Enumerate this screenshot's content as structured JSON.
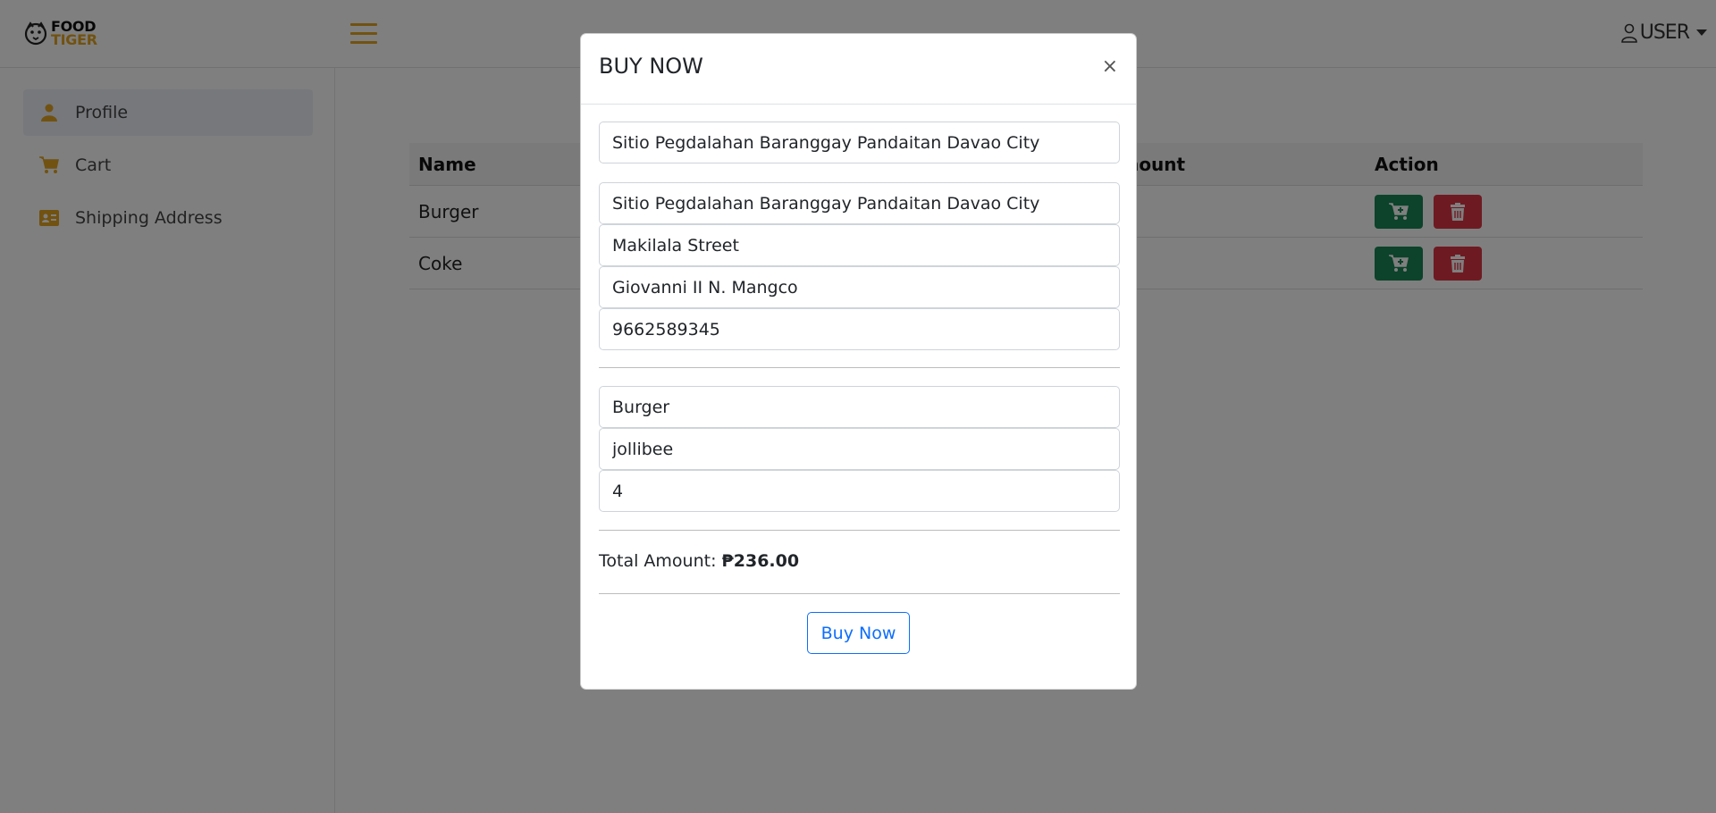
{
  "brand": {
    "line1": "FOOD",
    "line2": "TIGER"
  },
  "navbar": {
    "user_label": "USER"
  },
  "sidebar": {
    "items": [
      {
        "label": "Profile",
        "icon": "user-icon",
        "active": true
      },
      {
        "label": "Cart",
        "icon": "cart-icon",
        "active": false
      },
      {
        "label": "Shipping Address",
        "icon": "address-card-icon",
        "active": false
      }
    ]
  },
  "table": {
    "headers": {
      "name": "Name",
      "amount": "Amount",
      "action": "Action"
    },
    "rows": [
      {
        "name": "Burger"
      },
      {
        "name": "Coke"
      }
    ]
  },
  "modal": {
    "title": "BUY NOW",
    "close": "×",
    "address_select": "Sitio Pegdalahan Baranggay Pandaitan Davao City",
    "address": "Sitio Pegdalahan Baranggay Pandaitan Davao City",
    "street": "Makilala Street",
    "recipient": "Giovanni II N. Mangco",
    "phone": "9662589345",
    "product": "Burger",
    "store": "jollibee",
    "quantity": "4",
    "total_label": "Total Amount:",
    "total_value": "₱236.00",
    "buy_button": "Buy Now"
  },
  "colors": {
    "accent": "#e2a423",
    "cart_button": "#198754",
    "delete_button": "#dc3545",
    "primary": "#0d6efd"
  }
}
